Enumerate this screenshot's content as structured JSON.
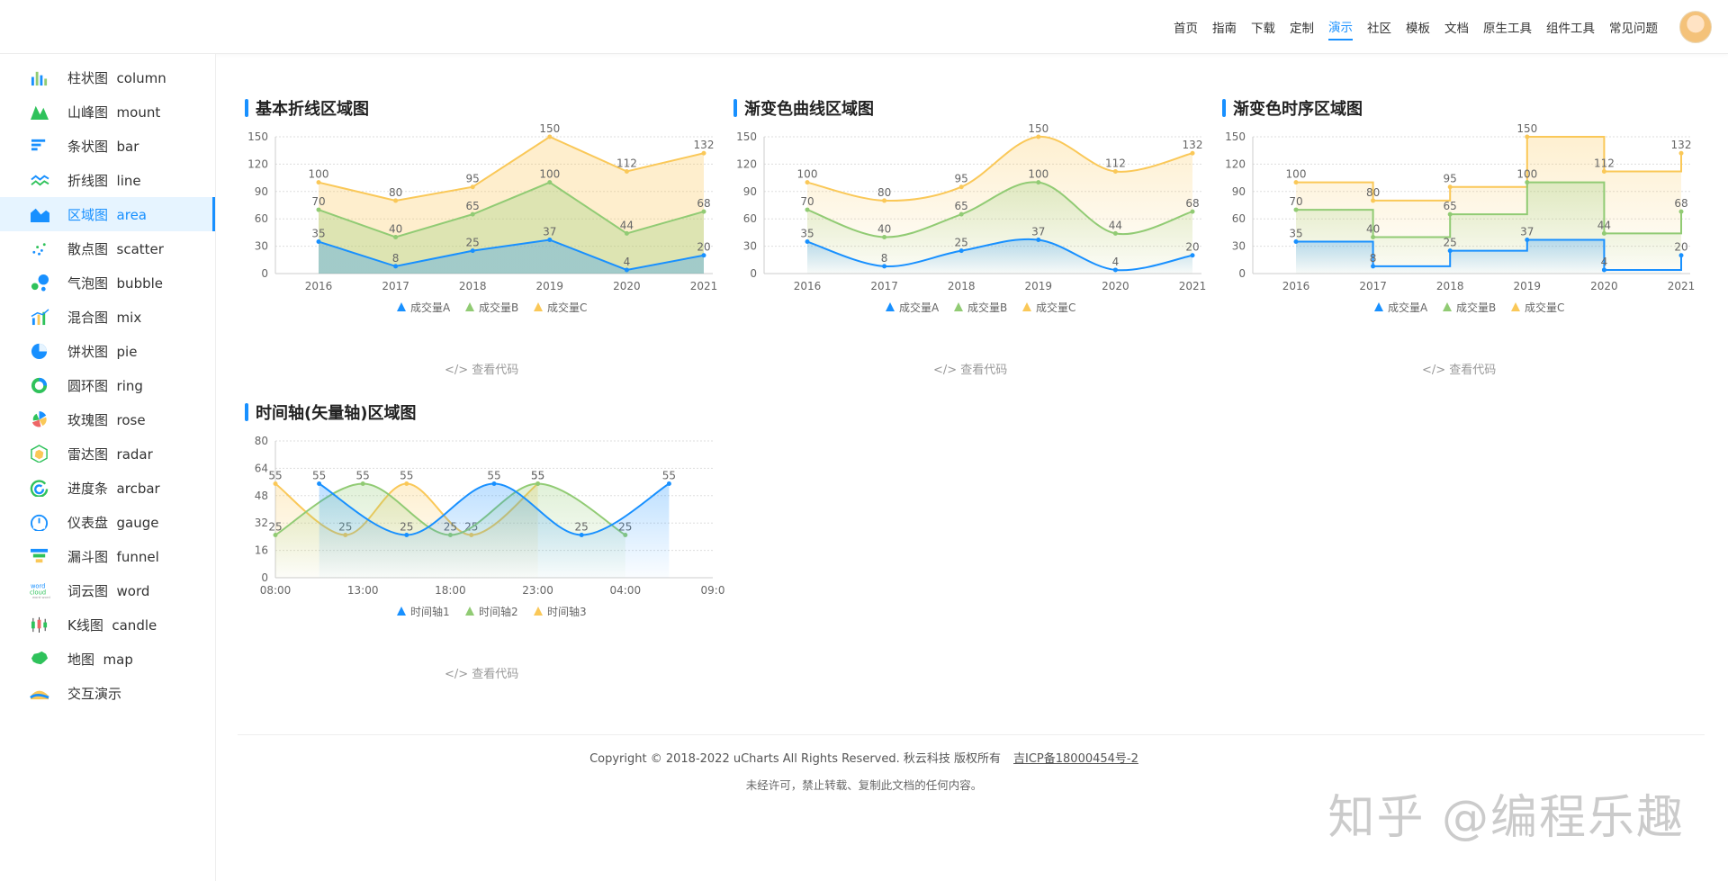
{
  "nav": {
    "items": [
      "首页",
      "指南",
      "下载",
      "定制",
      "演示",
      "社区",
      "模板",
      "文档",
      "原生工具",
      "组件工具",
      "常见问题"
    ],
    "active_index": 4
  },
  "sidebar": {
    "items": [
      {
        "label": "柱状图",
        "en": "column",
        "icon": "column-chart-icon"
      },
      {
        "label": "山峰图",
        "en": "mount",
        "icon": "mount-chart-icon"
      },
      {
        "label": "条状图",
        "en": "bar",
        "icon": "bar-chart-icon"
      },
      {
        "label": "折线图",
        "en": "line",
        "icon": "line-chart-icon"
      },
      {
        "label": "区域图",
        "en": "area",
        "icon": "area-chart-icon"
      },
      {
        "label": "散点图",
        "en": "scatter",
        "icon": "scatter-chart-icon"
      },
      {
        "label": "气泡图",
        "en": "bubble",
        "icon": "bubble-chart-icon"
      },
      {
        "label": "混合图",
        "en": "mix",
        "icon": "mix-chart-icon"
      },
      {
        "label": "饼状图",
        "en": "pie",
        "icon": "pie-chart-icon"
      },
      {
        "label": "圆环图",
        "en": "ring",
        "icon": "ring-chart-icon"
      },
      {
        "label": "玫瑰图",
        "en": "rose",
        "icon": "rose-chart-icon"
      },
      {
        "label": "雷达图",
        "en": "radar",
        "icon": "radar-chart-icon"
      },
      {
        "label": "进度条",
        "en": "arcbar",
        "icon": "arcbar-chart-icon"
      },
      {
        "label": "仪表盘",
        "en": "gauge",
        "icon": "gauge-chart-icon"
      },
      {
        "label": "漏斗图",
        "en": "funnel",
        "icon": "funnel-chart-icon"
      },
      {
        "label": "词云图",
        "en": "word",
        "icon": "word-cloud-icon"
      },
      {
        "label": "K线图",
        "en": "candle",
        "icon": "candle-chart-icon"
      },
      {
        "label": "地图",
        "en": "map",
        "icon": "map-chart-icon"
      },
      {
        "label": "交互演示",
        "en": "",
        "icon": "interactive-demo-icon"
      }
    ],
    "active_index": 4
  },
  "colors": {
    "accent": "#1890ff",
    "seriesA": "#1890ff",
    "seriesB": "#91cb74",
    "seriesC": "#fac858"
  },
  "code_link_label": "</> 查看代码",
  "chart_data": [
    {
      "type": "area",
      "style": "straight",
      "title": "基本折线区域图",
      "categories": [
        "2016",
        "2017",
        "2018",
        "2019",
        "2020",
        "2021"
      ],
      "yticks": [
        "0",
        "30",
        "60",
        "90",
        "120",
        "150"
      ],
      "ylim": [
        0,
        150
      ],
      "series": [
        {
          "name": "成交量A",
          "values": [
            35,
            8,
            25,
            37,
            4,
            20
          ]
        },
        {
          "name": "成交量B",
          "values": [
            70,
            40,
            65,
            100,
            44,
            68
          ]
        },
        {
          "name": "成交量C",
          "values": [
            100,
            80,
            95,
            150,
            112,
            132
          ]
        }
      ],
      "legend": "bottom"
    },
    {
      "type": "area",
      "style": "curve",
      "title": "渐变色曲线区域图",
      "categories": [
        "2016",
        "2017",
        "2018",
        "2019",
        "2020",
        "2021"
      ],
      "yticks": [
        "0",
        "30",
        "60",
        "90",
        "120",
        "150"
      ],
      "ylim": [
        0,
        150
      ],
      "series": [
        {
          "name": "成交量A",
          "values": [
            35,
            8,
            25,
            37,
            4,
            20
          ]
        },
        {
          "name": "成交量B",
          "values": [
            70,
            40,
            65,
            100,
            44,
            68
          ]
        },
        {
          "name": "成交量C",
          "values": [
            100,
            80,
            95,
            150,
            112,
            132
          ]
        }
      ],
      "legend": "bottom"
    },
    {
      "type": "area",
      "style": "step",
      "title": "渐变色时序区域图",
      "categories": [
        "2016",
        "2017",
        "2018",
        "2019",
        "2020",
        "2021"
      ],
      "yticks": [
        "0",
        "30",
        "60",
        "90",
        "120",
        "150"
      ],
      "ylim": [
        0,
        150
      ],
      "series": [
        {
          "name": "成交量A",
          "values": [
            35,
            8,
            25,
            37,
            4,
            20
          ]
        },
        {
          "name": "成交量B",
          "values": [
            70,
            40,
            65,
            100,
            44,
            68
          ]
        },
        {
          "name": "成交量C",
          "values": [
            100,
            80,
            95,
            150,
            112,
            132
          ]
        }
      ],
      "legend": "bottom"
    },
    {
      "type": "area",
      "style": "curve",
      "title": "时间轴(矢量轴)区域图",
      "xticks": [
        "08:00",
        "13:00",
        "18:00",
        "23:00",
        "04:00",
        "09:0"
      ],
      "xlim": [
        0,
        25
      ],
      "yticks": [
        "0",
        "16",
        "32",
        "48",
        "64",
        "80"
      ],
      "ylim": [
        0,
        80
      ],
      "series": [
        {
          "name": "时间轴1",
          "x": [
            2.5,
            7.5,
            12.5,
            17.5,
            22.5
          ],
          "values": [
            55,
            25,
            55,
            25,
            55
          ]
        },
        {
          "name": "时间轴2",
          "x": [
            0,
            5,
            10,
            15,
            20
          ],
          "values": [
            25,
            55,
            25,
            55,
            25
          ]
        },
        {
          "name": "时间轴3",
          "x": [
            0,
            4,
            7.5,
            11.2,
            15
          ],
          "values": [
            55,
            25,
            55,
            25,
            55
          ]
        }
      ],
      "legend": "bottom"
    }
  ],
  "footer": {
    "copyright": "Copyright © 2018-2022 uCharts All Rights Reserved. 秋云科技 版权所有",
    "icp": "吉ICP备18000454号-2",
    "notice": "未经许可，禁止转载、复制此文档的任何内容。"
  },
  "watermark": "知乎 @编程乐趣"
}
